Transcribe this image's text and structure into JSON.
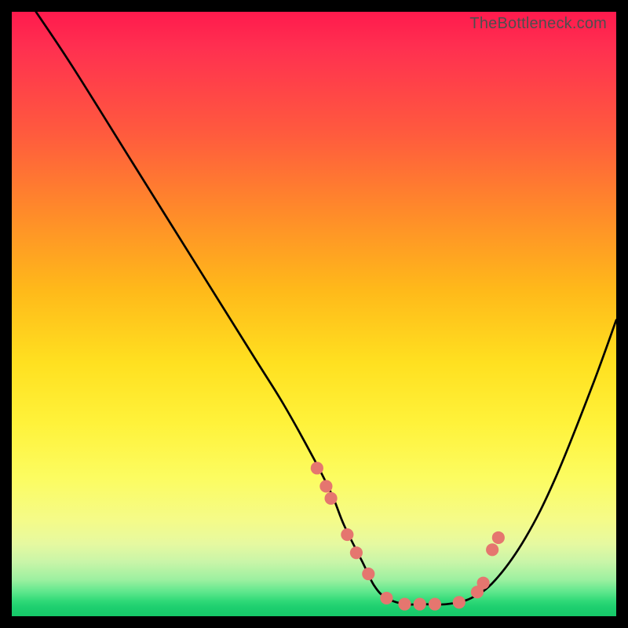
{
  "watermark": "TheBottleneck.com",
  "chart_data": {
    "type": "line",
    "title": "",
    "xlabel": "",
    "ylabel": "",
    "xlim": [
      0,
      100
    ],
    "ylim": [
      0,
      100
    ],
    "series": [
      {
        "name": "curve",
        "x": [
          4,
          10,
          20,
          30,
          40,
          45,
          50,
          53,
          55,
          58,
          60,
          62,
          65,
          68,
          72,
          76,
          80,
          85,
          90,
          96,
          100
        ],
        "values": [
          100,
          91,
          75,
          59,
          43,
          35,
          26,
          20,
          15,
          9,
          5,
          3,
          2,
          2,
          2,
          3,
          6,
          13,
          23,
          38,
          49
        ]
      }
    ],
    "markers": {
      "name": "dots",
      "color": "#e5766f",
      "x": [
        50.5,
        52.0,
        52.8,
        55.5,
        57.0,
        59.0,
        62.0,
        65.0,
        67.5,
        70.0,
        74.0,
        77.0,
        78.0,
        79.5,
        80.5
      ],
      "values": [
        24.5,
        21.5,
        19.5,
        13.5,
        10.5,
        7.0,
        3.0,
        2.0,
        2.0,
        2.0,
        2.3,
        4.0,
        5.5,
        11.0,
        13.0
      ]
    }
  }
}
